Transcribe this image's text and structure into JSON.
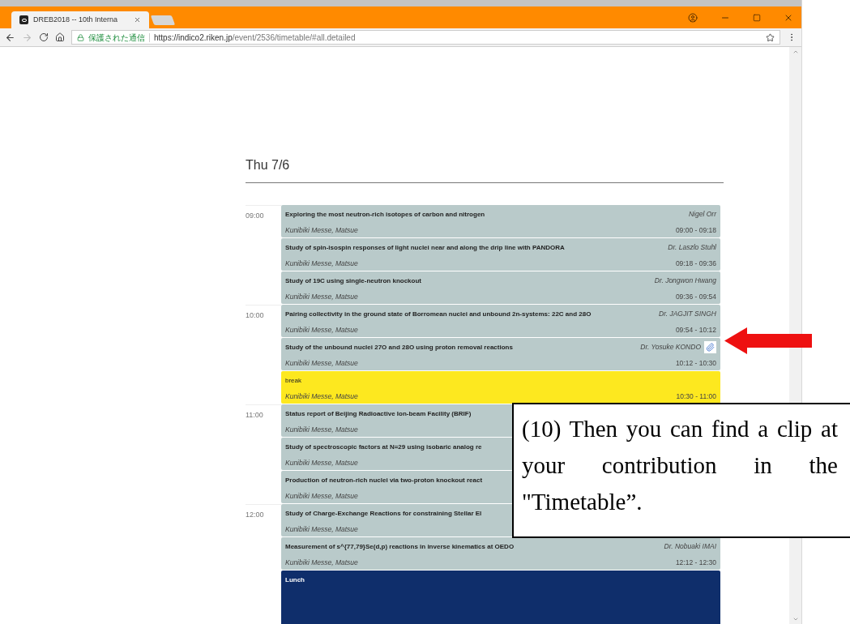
{
  "browser": {
    "tabs": [
      {
        "title": "DREB2018 -- 10th Interna",
        "selected": true
      }
    ],
    "navigation": {
      "back_disabled": false,
      "forward_disabled": true
    },
    "address": {
      "security_label": "保護された通信",
      "url_host": "https://indico2.riken.jp",
      "url_path": "/event/2536/timetable/#all.detailed"
    }
  },
  "timetable": {
    "day": "Thu 7/6",
    "entries": [
      {
        "kind": "talk",
        "hour_label": "09:00",
        "title": "Exploring the most neutron-rich isotopes of carbon and nitrogen",
        "speaker": "Nigel Orr",
        "location": "Kunibiki Messe, Matsue",
        "time": "09:00 - 09:18",
        "has_attachment": false
      },
      {
        "kind": "talk",
        "title": "Study of spin-isospin responses of light nuclei near and along the drip line with PANDORA",
        "speaker": "Dr. Laszlo Stuhl",
        "location": "Kunibiki Messe, Matsue",
        "time": "09:18 - 09:36",
        "has_attachment": false
      },
      {
        "kind": "talk",
        "title": "Study of 19C using single-neutron knockout",
        "speaker": "Dr. Jongwon Hwang",
        "location": "Kunibiki Messe, Matsue",
        "time": "09:36 - 09:54",
        "has_attachment": false
      },
      {
        "kind": "talk",
        "hour_label": "10:00",
        "title": "Pairing collectivity in the ground state of Borromean nuclei and unbound 2n-systems: 22C and 28O",
        "speaker": "Dr. JAGJIT SINGH",
        "location": "Kunibiki Messe, Matsue",
        "time": "09:54 - 10:12",
        "has_attachment": false
      },
      {
        "kind": "talk",
        "title": "Study of the unbound nuclei 27O and 28O using proton removal reactions",
        "speaker": "Dr. Yosuke KONDO",
        "location": "Kunibiki Messe, Matsue",
        "time": "10:12 - 10:30",
        "has_attachment": true
      },
      {
        "kind": "break",
        "title": "break",
        "location": "Kunibiki Messe, Matsue",
        "time": "10:30 - 11:00"
      },
      {
        "kind": "talk",
        "hour_label": "11:00",
        "title": "Status report of Beijing Radioactive Ion-beam Facility (BRIF)",
        "location": "Kunibiki Messe, Matsue",
        "has_attachment": false
      },
      {
        "kind": "talk",
        "title": "Study of spectroscopic factors at N=29 using isobaric analog re",
        "location": "Kunibiki Messe, Matsue",
        "has_attachment": false
      },
      {
        "kind": "talk",
        "title": "Production of neutron-rich nuclei via two-proton knockout react",
        "location": "Kunibiki Messe, Matsue",
        "has_attachment": false
      },
      {
        "kind": "talk",
        "hour_label": "12:00",
        "title": "Study of Charge-Exchange Reactions for constraining Stellar El",
        "location": "Kunibiki Messe, Matsue",
        "has_attachment": false
      },
      {
        "kind": "talk",
        "title": "Measurement of s^{77,79}Se(d,p) reactions in inverse kinematics at OEDO",
        "speaker": "Dr. Nobuaki IMAI",
        "location": "Kunibiki Messe, Matsue",
        "time": "12:12 - 12:30",
        "has_attachment": false
      },
      {
        "kind": "lunch",
        "title": "Lunch"
      }
    ]
  },
  "callout": {
    "text": "(10) Then you can find a clip at your contribution in the \"Timetable”."
  }
}
